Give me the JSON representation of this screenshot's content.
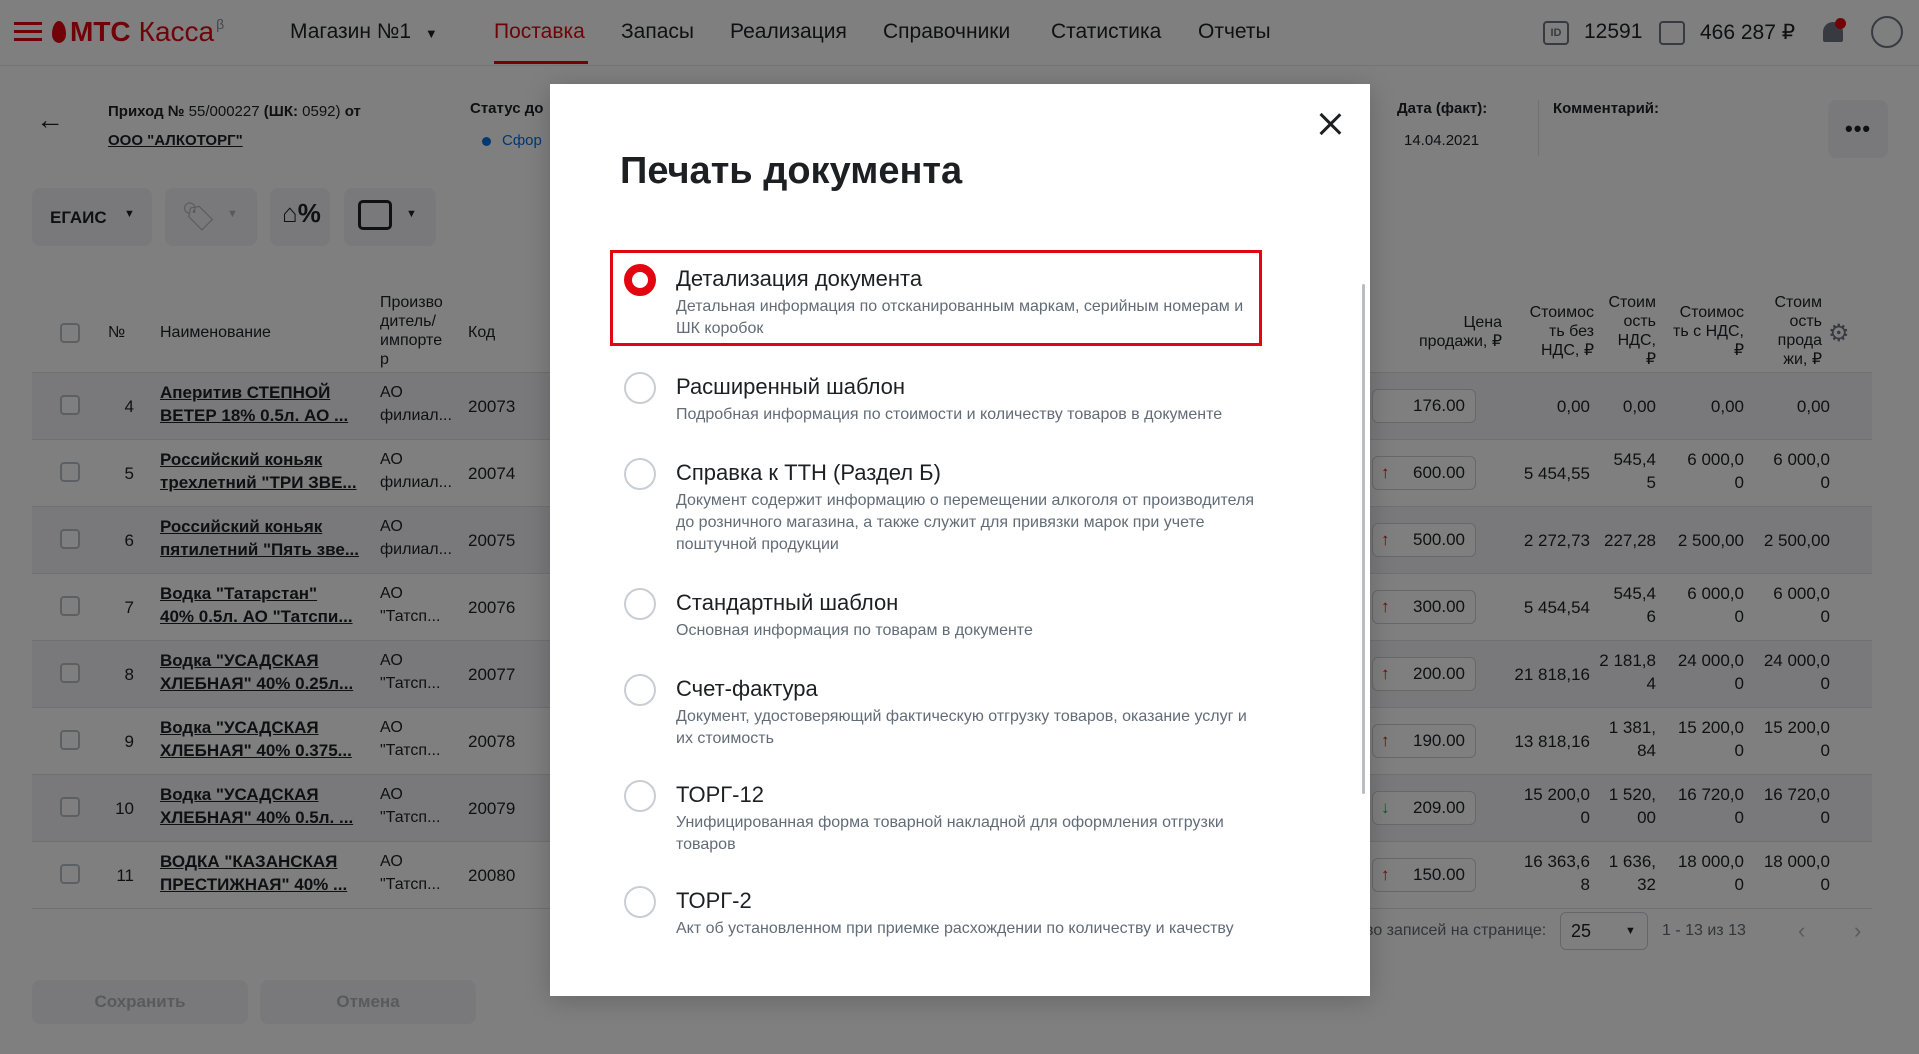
{
  "app": {
    "brand": "МТС",
    "product": "Касса",
    "beta": "β"
  },
  "header": {
    "store": "Магазин №1",
    "nav": [
      "Поставка",
      "Запасы",
      "Реализация",
      "Справочники",
      "Статистика",
      "Отчеты"
    ],
    "id_value": "12591",
    "balance": "466 287 ₽"
  },
  "doc": {
    "title_prefix": "Приход №",
    "title_rest": " 55/000227 ",
    "shk_label": "(ШК:",
    "shk_value": " 0592) ",
    "from": "от",
    "supplier": "ООО \"АЛКОТОРГ\"",
    "status_label": "Статус до",
    "status_value": "Сфор",
    "date_label": "Дата (факт):",
    "date_value": "14.04.2021",
    "comment_label": "Комментарий:"
  },
  "toolbar": {
    "egais": "ЕГАИС"
  },
  "table": {
    "headers": {
      "num": "№",
      "name": "Наименование",
      "producer": "Произво\nдитель/\nимпорте\nр",
      "code": "Код",
      "sale_price": "Цена\nпродажи, ₽",
      "cost_no_vat": "Стоимос\nть без\nНДС, ₽",
      "vat_cost": "Стоим\nость\nНДС,\n₽",
      "cost_with_vat": "Стоимос\nть с НДС,\n₽",
      "sale_cost": "Стоим\nость\nпрода\nжи, ₽"
    },
    "rows": [
      {
        "n": "4",
        "name": "Аперитив СТЕПНОЙ\nВЕТЕР 18% 0.5л. АО ...",
        "producer": "АО\nфилиал...",
        "code": "20073",
        "arrow": "",
        "price": "176.00",
        "c1": "0,00",
        "c2": "0,00",
        "c3": "0,00",
        "c4": "0,00"
      },
      {
        "n": "5",
        "name": "Российский коньяк\nтрехлетний \"ТРИ ЗВЕ...",
        "producer": "АО\nфилиал...",
        "code": "20074",
        "arrow": "up",
        "price": "600.00",
        "c1": "5 454,55",
        "c2": "545,4\n5",
        "c3": "6 000,0\n0",
        "c4": "6 000,0\n0"
      },
      {
        "n": "6",
        "name": "Российский коньяк\nпятилетний \"Пять зве...",
        "producer": "АО\nфилиал...",
        "code": "20075",
        "arrow": "up",
        "price": "500.00",
        "c1": "2 272,73",
        "c2": "227,28",
        "c3": "2 500,00",
        "c4": "2 500,00"
      },
      {
        "n": "7",
        "name": "Водка \"Татарстан\"\n40% 0.5л. АО \"Татспи...",
        "producer": "АО\n\"Татсп...",
        "code": "20076",
        "arrow": "up",
        "price": "300.00",
        "c1": "5 454,54",
        "c2": "545,4\n6",
        "c3": "6 000,0\n0",
        "c4": "6 000,0\n0"
      },
      {
        "n": "8",
        "name": "Водка \"УСАДСКАЯ\nХЛЕБНАЯ\" 40% 0.25л...",
        "producer": "АО\n\"Татсп...",
        "code": "20077",
        "arrow": "up",
        "price": "200.00",
        "c1": "21 818,16",
        "c2": "2 181,8\n4",
        "c3": "24 000,0\n0",
        "c4": "24 000,0\n0"
      },
      {
        "n": "9",
        "name": "Водка \"УСАДСКАЯ\nХЛЕБНАЯ\" 40% 0.375...",
        "producer": "АО\n\"Татсп...",
        "code": "20078",
        "arrow": "up",
        "price": "190.00",
        "c1": "13 818,16",
        "c2": "1 381,\n84",
        "c3": "15 200,0\n0",
        "c4": "15 200,0\n0"
      },
      {
        "n": "10",
        "name": "Водка \"УСАДСКАЯ\nХЛЕБНАЯ\" 40% 0.5л. ...",
        "producer": "АО\n\"Татсп...",
        "code": "20079",
        "arrow": "down",
        "price": "209.00",
        "c1": "15 200,0\n0",
        "c2": "1 520,\n00",
        "c3": "16 720,0\n0",
        "c4": "16 720,0\n0"
      },
      {
        "n": "11",
        "name": "ВОДКА \"КАЗАНСКАЯ\nПРЕСТИЖНАЯ\" 40% ...",
        "producer": "АО\n\"Татсп...",
        "code": "20080",
        "arrow": "up",
        "price": "150.00",
        "c1": "16 363,6\n8",
        "c2": "1 636,\n32",
        "c3": "18 000,0\n0",
        "c4": "18 000,0\n0"
      }
    ]
  },
  "pagination": {
    "label": "во записей на странице:",
    "per_page": "25",
    "range": "1 - 13 из 13"
  },
  "footer": {
    "save": "Сохранить",
    "cancel": "Отмена"
  },
  "modal": {
    "title": "Печать документа",
    "options": [
      {
        "title": "Детализация документа",
        "desc": "Детальная информация по отсканированным маркам, серийным номерам и ШК коробок",
        "checked": true
      },
      {
        "title": "Расширенный шаблон",
        "desc": "Подробная информация по стоимости и количеству товаров в документе",
        "checked": false
      },
      {
        "title": "Справка к ТТН (Раздел Б)",
        "desc": "Документ содержит информацию о перемещении алкоголя от производителя до розничного магазина, а также служит для привязки марок при учете поштучной продукции",
        "checked": false
      },
      {
        "title": "Стандартный шаблон",
        "desc": "Основная информация по товарам в документе",
        "checked": false
      },
      {
        "title": "Счет-фактура",
        "desc": "Документ, удостоверяющий фактическую отгрузку товаров, оказание услуг и их стоимость",
        "checked": false
      },
      {
        "title": "ТОРГ-12",
        "desc": "Унифицированная форма товарной накладной для оформления отгрузки товаров",
        "checked": false
      },
      {
        "title": "ТОРГ-2",
        "desc": "Акт об установленном при приемке расхождении по количеству и качеству",
        "checked": false
      }
    ]
  },
  "colors": {
    "accent": "#e30611",
    "overlay": "rgba(0,0,0,0.5)",
    "price_col": "#fbf5b6",
    "up_arrow": "#e30611",
    "down_arrow": "#26a65b"
  }
}
